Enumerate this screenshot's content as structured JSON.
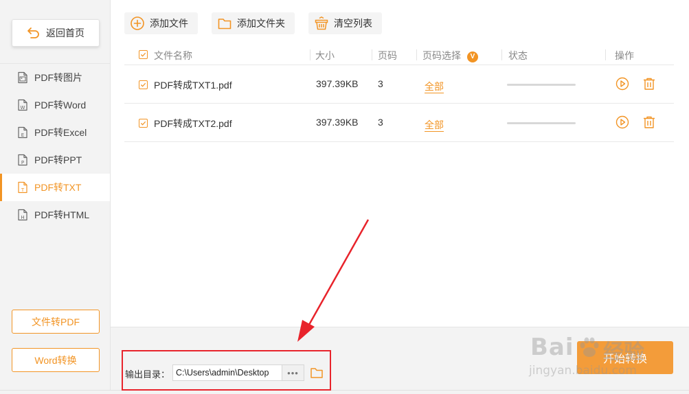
{
  "sidebar": {
    "home_label": "返回首页",
    "items": [
      {
        "label": "PDF转图片",
        "icon": "image-file-icon",
        "glyph": "",
        "active": false
      },
      {
        "label": "PDF转Word",
        "icon": "word-file-icon",
        "glyph": "W",
        "active": false
      },
      {
        "label": "PDF转Excel",
        "icon": "excel-file-icon",
        "glyph": "E",
        "active": false
      },
      {
        "label": "PDF转PPT",
        "icon": "ppt-file-icon",
        "glyph": "P",
        "active": false
      },
      {
        "label": "PDF转TXT",
        "icon": "txt-file-icon",
        "glyph": "T",
        "active": true
      },
      {
        "label": "PDF转HTML",
        "icon": "html-file-icon",
        "glyph": "H",
        "active": false
      }
    ],
    "file_to_pdf_label": "文件转PDF",
    "word_convert_label": "Word转换"
  },
  "toolbar": {
    "add_file_label": "添加文件",
    "add_folder_label": "添加文件夹",
    "clear_list_label": "清空列表"
  },
  "table": {
    "columns": {
      "name": "文件名称",
      "size": "大小",
      "pages": "页码",
      "page_select": "页码选择",
      "page_select_badge": "V",
      "status": "状态",
      "actions": "操作"
    },
    "rows": [
      {
        "name": "PDF转成TXT1.pdf",
        "size": "397.39KB",
        "pages": "3",
        "page_select": "全部",
        "progress": 0
      },
      {
        "name": "PDF转成TXT2.pdf",
        "size": "397.39KB",
        "pages": "3",
        "page_select": "全部",
        "progress": 0
      }
    ]
  },
  "output": {
    "label": "输出目录：",
    "path": "C:\\Users\\admin\\Desktop",
    "browse_label": "•••"
  },
  "start_label": "开始转换",
  "watermark": {
    "brand": "Bai",
    "brand_cn": "经验",
    "url": "jingyan.baidu.com"
  },
  "colors": {
    "accent": "#f29424",
    "highlight": "#e8232b"
  }
}
